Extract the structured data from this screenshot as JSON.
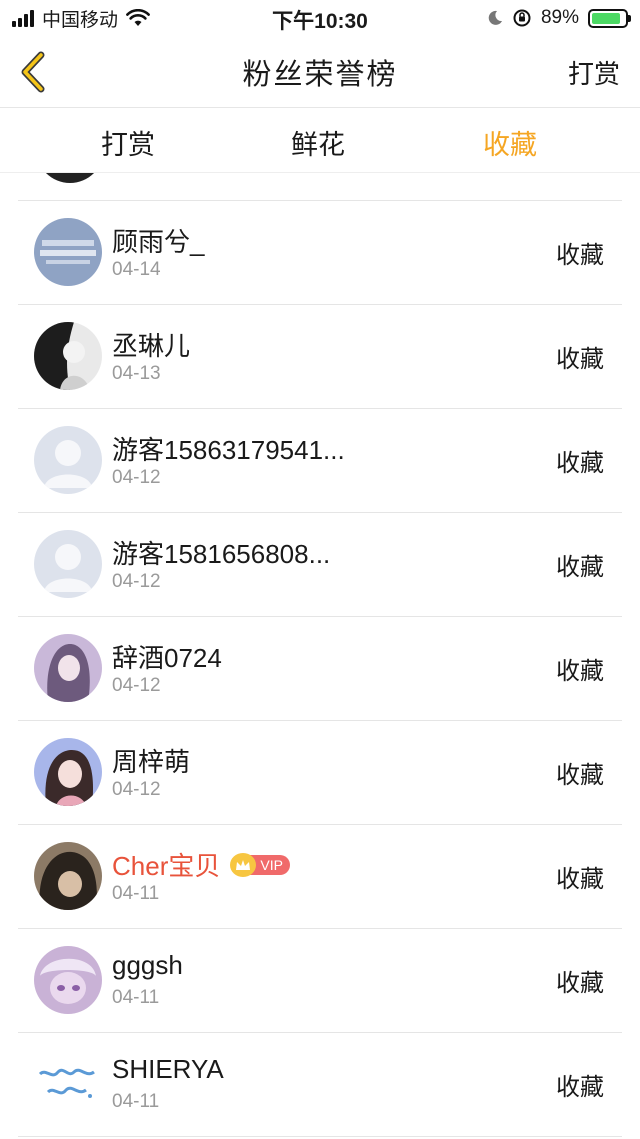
{
  "status_bar": {
    "carrier": "中国移动",
    "time": "下午10:30",
    "battery": "89%",
    "battery_level": 0.89
  },
  "nav": {
    "title": "粉丝荣誉榜",
    "action_label": "打赏",
    "back_icon": "chevron-left-icon"
  },
  "tabs": [
    {
      "label": "打赏",
      "active": false
    },
    {
      "label": "鲜花",
      "active": false
    },
    {
      "label": "收藏",
      "active": true
    }
  ],
  "colors": {
    "accent": "#f5a623",
    "vip_name": "#e8533b",
    "date": "#9a9a9a"
  },
  "rows": [
    {
      "name": "顾雨兮_",
      "date": "04-14",
      "action": "收藏"
    },
    {
      "name": "丞琳儿",
      "date": "04-13",
      "action": "收藏"
    },
    {
      "name": "游客15863179541...",
      "date": "04-12",
      "action": "收藏"
    },
    {
      "name": "游客1581656808...",
      "date": "04-12",
      "action": "收藏"
    },
    {
      "name": "辞酒0724",
      "date": "04-12",
      "action": "收藏"
    },
    {
      "name": "周梓萌",
      "date": "04-12",
      "action": "收藏"
    },
    {
      "name": "Cher宝贝",
      "date": "04-11",
      "action": "收藏",
      "vip_label": "VIP"
    },
    {
      "name": "gggsh",
      "date": "04-11",
      "action": "收藏"
    },
    {
      "name": "SHIERYA",
      "date": "04-11",
      "action": "收藏"
    }
  ]
}
